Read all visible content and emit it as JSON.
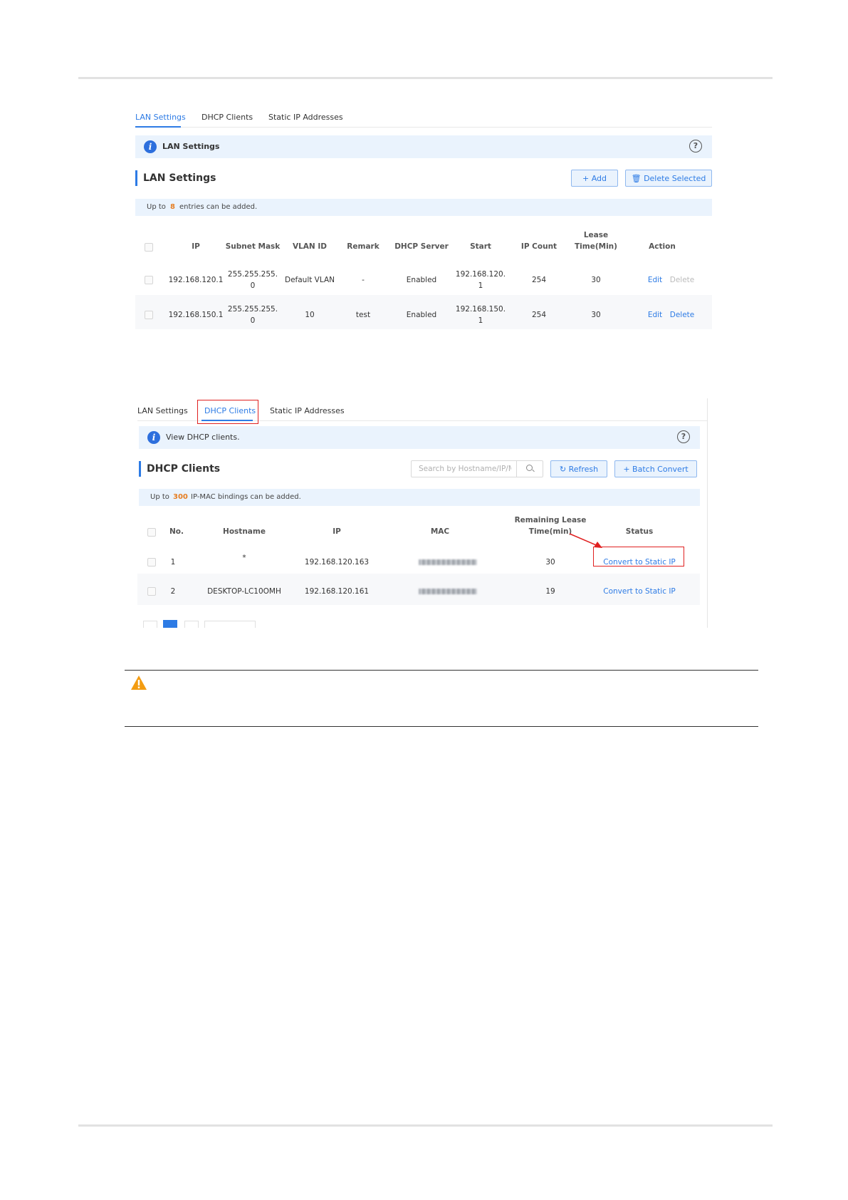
{
  "lan_panel": {
    "tabs": [
      "LAN Settings",
      "DHCP Clients",
      "Static IP Addresses"
    ],
    "info_text": "LAN Settings",
    "section_title": "LAN Settings",
    "add_label": "+ Add",
    "delete_selected_label": "Delete Selected",
    "notice_prefix": "Up to",
    "notice_count": "8",
    "notice_suffix": "entries can be added.",
    "columns": [
      "IP",
      "Subnet Mask",
      "VLAN ID",
      "Remark",
      "DHCP Server",
      "Start",
      "IP Count",
      "Lease\nTime(Min)",
      "Action"
    ],
    "rows": [
      {
        "ip": "192.168.120.1",
        "mask1": "255.255.255.",
        "mask2": "0",
        "vlan": "Default VLAN",
        "remark": "-",
        "dhcp": "Enabled",
        "start1": "192.168.120.",
        "start2": "1",
        "count": "254",
        "lease": "30",
        "edit": "Edit",
        "delete": "Delete"
      },
      {
        "ip": "192.168.150.1",
        "mask1": "255.255.255.",
        "mask2": "0",
        "vlan": "10",
        "remark": "test",
        "dhcp": "Enabled",
        "start1": "192.168.150.",
        "start2": "1",
        "count": "254",
        "lease": "30",
        "edit": "Edit",
        "delete": "Delete"
      }
    ]
  },
  "dhcp_panel": {
    "tabs": [
      "LAN Settings",
      "DHCP Clients",
      "Static IP Addresses"
    ],
    "info_text": "View DHCP clients.",
    "section_title": "DHCP Clients",
    "search_placeholder": "Search by Hostname/IP/MAC",
    "refresh_label": "Refresh",
    "batch_convert_label": "+ Batch Convert",
    "notice_prefix": "Up to",
    "notice_count": "300",
    "notice_suffix": "IP-MAC bindings can be added.",
    "columns": [
      "No.",
      "Hostname",
      "IP",
      "MAC",
      "Remaining Lease\nTime(min)",
      "Status"
    ],
    "rows": [
      {
        "no": "1",
        "hostname": "*",
        "ip": "192.168.120.163",
        "lease": "30",
        "status": "Convert to Static IP"
      },
      {
        "no": "2",
        "hostname": "DESKTOP-LC10OMH",
        "ip": "192.168.120.161",
        "lease": "19",
        "status": "Convert to Static IP"
      }
    ]
  },
  "colors": {
    "accent": "#2d7be5",
    "highlight": "#e67e22",
    "annotation": "#e02020"
  },
  "icons": [
    "info-icon",
    "help-icon",
    "trash-icon",
    "refresh-icon",
    "search-icon",
    "warning-icon",
    "checkbox-icon"
  ]
}
